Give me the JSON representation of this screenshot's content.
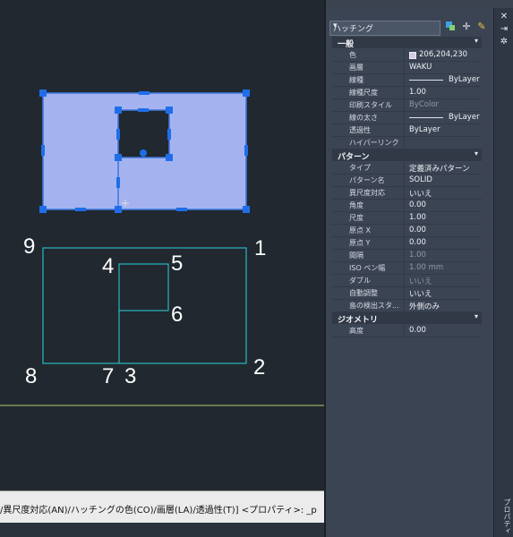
{
  "command_line": {
    "text": "/異尺度対応(AN)/ハッチングの色(CO)/画層(LA)/透過性(T)] <プロパティ>: _p"
  },
  "drawing": {
    "labels": [
      "1",
      "2",
      "3",
      "4",
      "5",
      "6",
      "7",
      "8",
      "9"
    ]
  },
  "properties": {
    "object_type": "ハッチング",
    "sections": [
      {
        "title": "一般",
        "rows": [
          {
            "key": "色",
            "value": "206,204,230",
            "kind": "swatch"
          },
          {
            "key": "画層",
            "value": "WAKU"
          },
          {
            "key": "線種",
            "value": "ByLayer",
            "kind": "line"
          },
          {
            "key": "線種尺度",
            "value": "1.00"
          },
          {
            "key": "印刷スタイル",
            "value": "ByColor",
            "kind": "dim"
          },
          {
            "key": "線の太さ",
            "value": "ByLayer",
            "kind": "line"
          },
          {
            "key": "透過性",
            "value": "ByLayer"
          },
          {
            "key": "ハイパーリンク",
            "value": ""
          }
        ]
      },
      {
        "title": "パターン",
        "rows": [
          {
            "key": "タイプ",
            "value": "定義済みパターン"
          },
          {
            "key": "パターン名",
            "value": "SOLID"
          },
          {
            "key": "異尺度対応",
            "value": "いいえ"
          },
          {
            "key": "角度",
            "value": "0.00"
          },
          {
            "key": "尺度",
            "value": "1.00"
          },
          {
            "key": "原点 X",
            "value": "0.00"
          },
          {
            "key": "原点 Y",
            "value": "0.00"
          },
          {
            "key": "間隔",
            "value": "1.00",
            "kind": "dim"
          },
          {
            "key": "ISO ペン幅",
            "value": "1.00 mm",
            "kind": "dim"
          },
          {
            "key": "ダブル",
            "value": "いいえ",
            "kind": "dim"
          },
          {
            "key": "自動調整",
            "value": "いいえ"
          },
          {
            "key": "島の検出スタ...",
            "value": "外側のみ"
          }
        ]
      },
      {
        "title": "ジオメトリ",
        "rows": [
          {
            "key": "高度",
            "value": "0.00"
          }
        ]
      }
    ],
    "palette_title": "プロパティ"
  },
  "colors": {
    "canvas_bg": "#212830",
    "hatch_fill": "#a4b3f0",
    "hatch_border": "#3c78e0",
    "grip": "#1f6ee8",
    "cyan_line": "#2ab8c0",
    "ground_line": "#b7c46c"
  },
  "icons": {
    "dropdown": "chevron-down-icon",
    "quick_select": "quick-select-icon",
    "select_objects": "select-objects-icon",
    "pickadd": "pickadd-icon",
    "close": "close-icon",
    "autohide": "autohide-icon",
    "settings": "settings-icon",
    "collapse": "chevron-down-icon"
  }
}
